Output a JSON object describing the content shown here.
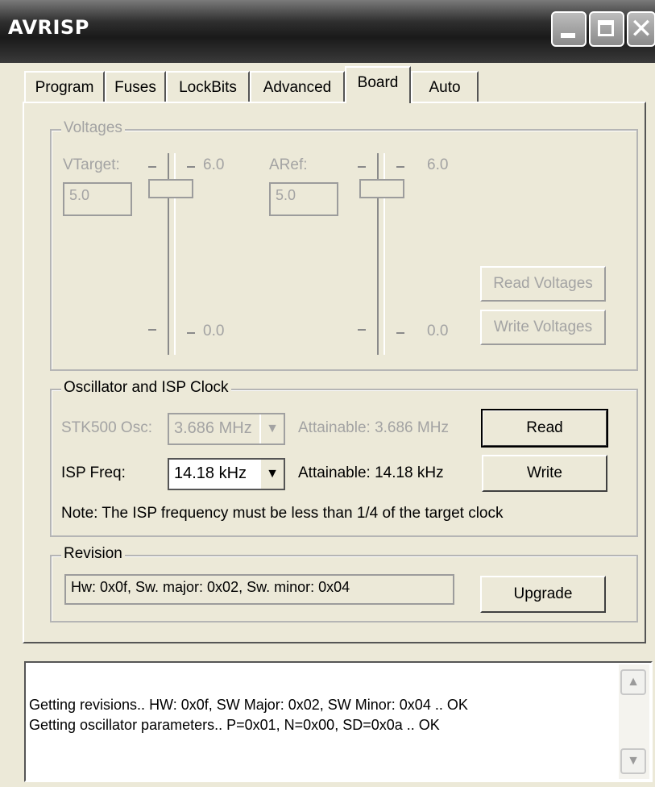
{
  "window": {
    "title": "AVRISP",
    "controls": {
      "minimize_icon": "minimize-icon",
      "maximize_icon": "maximize-icon",
      "close_icon": "close-icon"
    }
  },
  "tabs": [
    {
      "label": "Program"
    },
    {
      "label": "Fuses"
    },
    {
      "label": "LockBits"
    },
    {
      "label": "Advanced"
    },
    {
      "label": "Board",
      "active": true
    },
    {
      "label": "Auto"
    }
  ],
  "voltages": {
    "title": "Voltages",
    "vtarget_label": "VTarget:",
    "vtarget_value": "5.0",
    "vtarget_max": "6.0",
    "vtarget_min": "0.0",
    "aref_label": "ARef:",
    "aref_value": "5.0",
    "aref_max": "6.0",
    "aref_min": "0.0",
    "read_button": "Read Voltages",
    "write_button": "Write Voltages"
  },
  "oscillator": {
    "title": "Oscillator and ISP Clock",
    "stk_label": "STK500 Osc:",
    "stk_value": "3.686 MHz",
    "stk_attainable": "Attainable: 3.686 MHz",
    "isp_label": "ISP Freq:",
    "isp_value": "14.18 kHz",
    "isp_attainable": "Attainable: 14.18 kHz",
    "read_button": "Read",
    "write_button": "Write",
    "note": "Note: The ISP frequency must be less than 1/4 of the target clock"
  },
  "revision": {
    "title": "Revision",
    "value": "Hw: 0x0f, Sw. major: 0x02, Sw. minor: 0x04",
    "upgrade_button": "Upgrade"
  },
  "status_log": {
    "lines": [
      "Getting revisions.. HW: 0x0f, SW Major: 0x02, SW Minor: 0x04 .. OK",
      "Getting oscillator parameters.. P=0x01, N=0x00, SD=0x0a .. OK"
    ]
  },
  "colors": {
    "window_bg": "#ece9d8",
    "disabled_text": "#a3a3a3"
  }
}
